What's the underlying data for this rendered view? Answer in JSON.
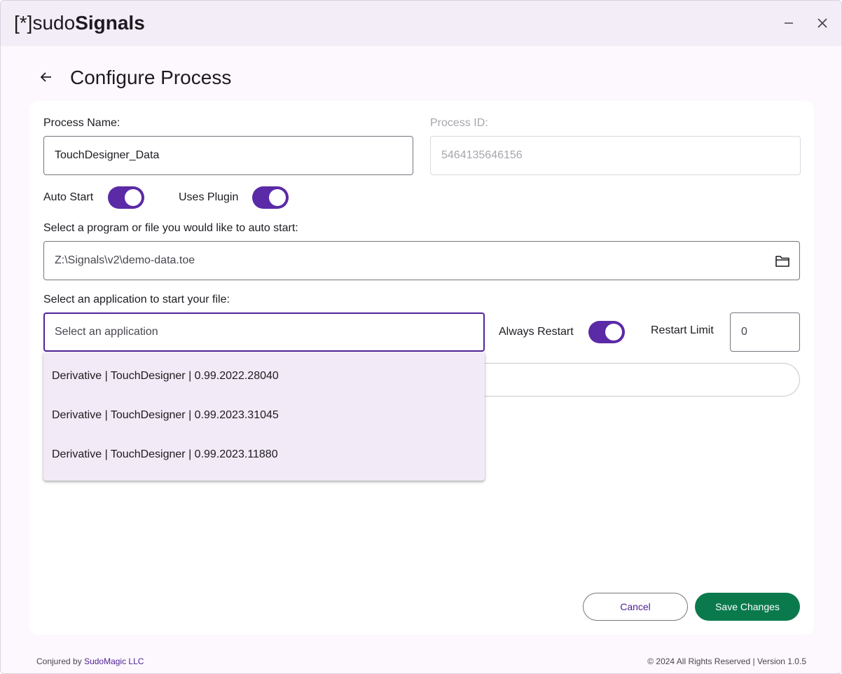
{
  "app": {
    "logo_bracket": "[*]",
    "logo_light": "sudo",
    "logo_bold": "Signals",
    "minimize_icon": "minimize-icon",
    "close_icon": "close-icon"
  },
  "header": {
    "title": "Configure Process",
    "back_icon": "arrow-back-icon"
  },
  "form": {
    "process_name_label": "Process Name:",
    "process_name_value": "TouchDesigner_Data",
    "process_id_label": "Process ID:",
    "process_id_value": "5464135646156",
    "auto_start_label": "Auto Start",
    "auto_start_on": true,
    "uses_plugin_label": "Uses Plugin",
    "uses_plugin_on": true,
    "program_label": "Select a program or file you would like to auto start:",
    "program_value": "Z:\\Signals\\v2\\demo-data.toe",
    "folder_icon": "folder-icon",
    "application_label": "Select an application to start your file:",
    "application_placeholder": "Select an application",
    "always_restart_label": "Always Restart",
    "always_restart_on": true,
    "restart_limit_label": "Restart Limit",
    "restart_limit_value": "0"
  },
  "dropdown": {
    "options": [
      "Derivative | TouchDesigner | 0.99.2022.28040",
      "Derivative | TouchDesigner | 0.99.2023.31045",
      "Derivative | TouchDesigner | 0.99.2023.11880"
    ]
  },
  "actions": {
    "cancel_label": "Cancel",
    "save_label": "Save Changes"
  },
  "footer": {
    "conjured_by": "Conjured by",
    "company": "SudoMagic LLC",
    "rights": "© 2024 All Rights Reserved | Version 1.0.5"
  },
  "colors": {
    "accent": "#5b2aa6",
    "save": "#0a7a4d",
    "titlebar": "#f3edf7"
  }
}
